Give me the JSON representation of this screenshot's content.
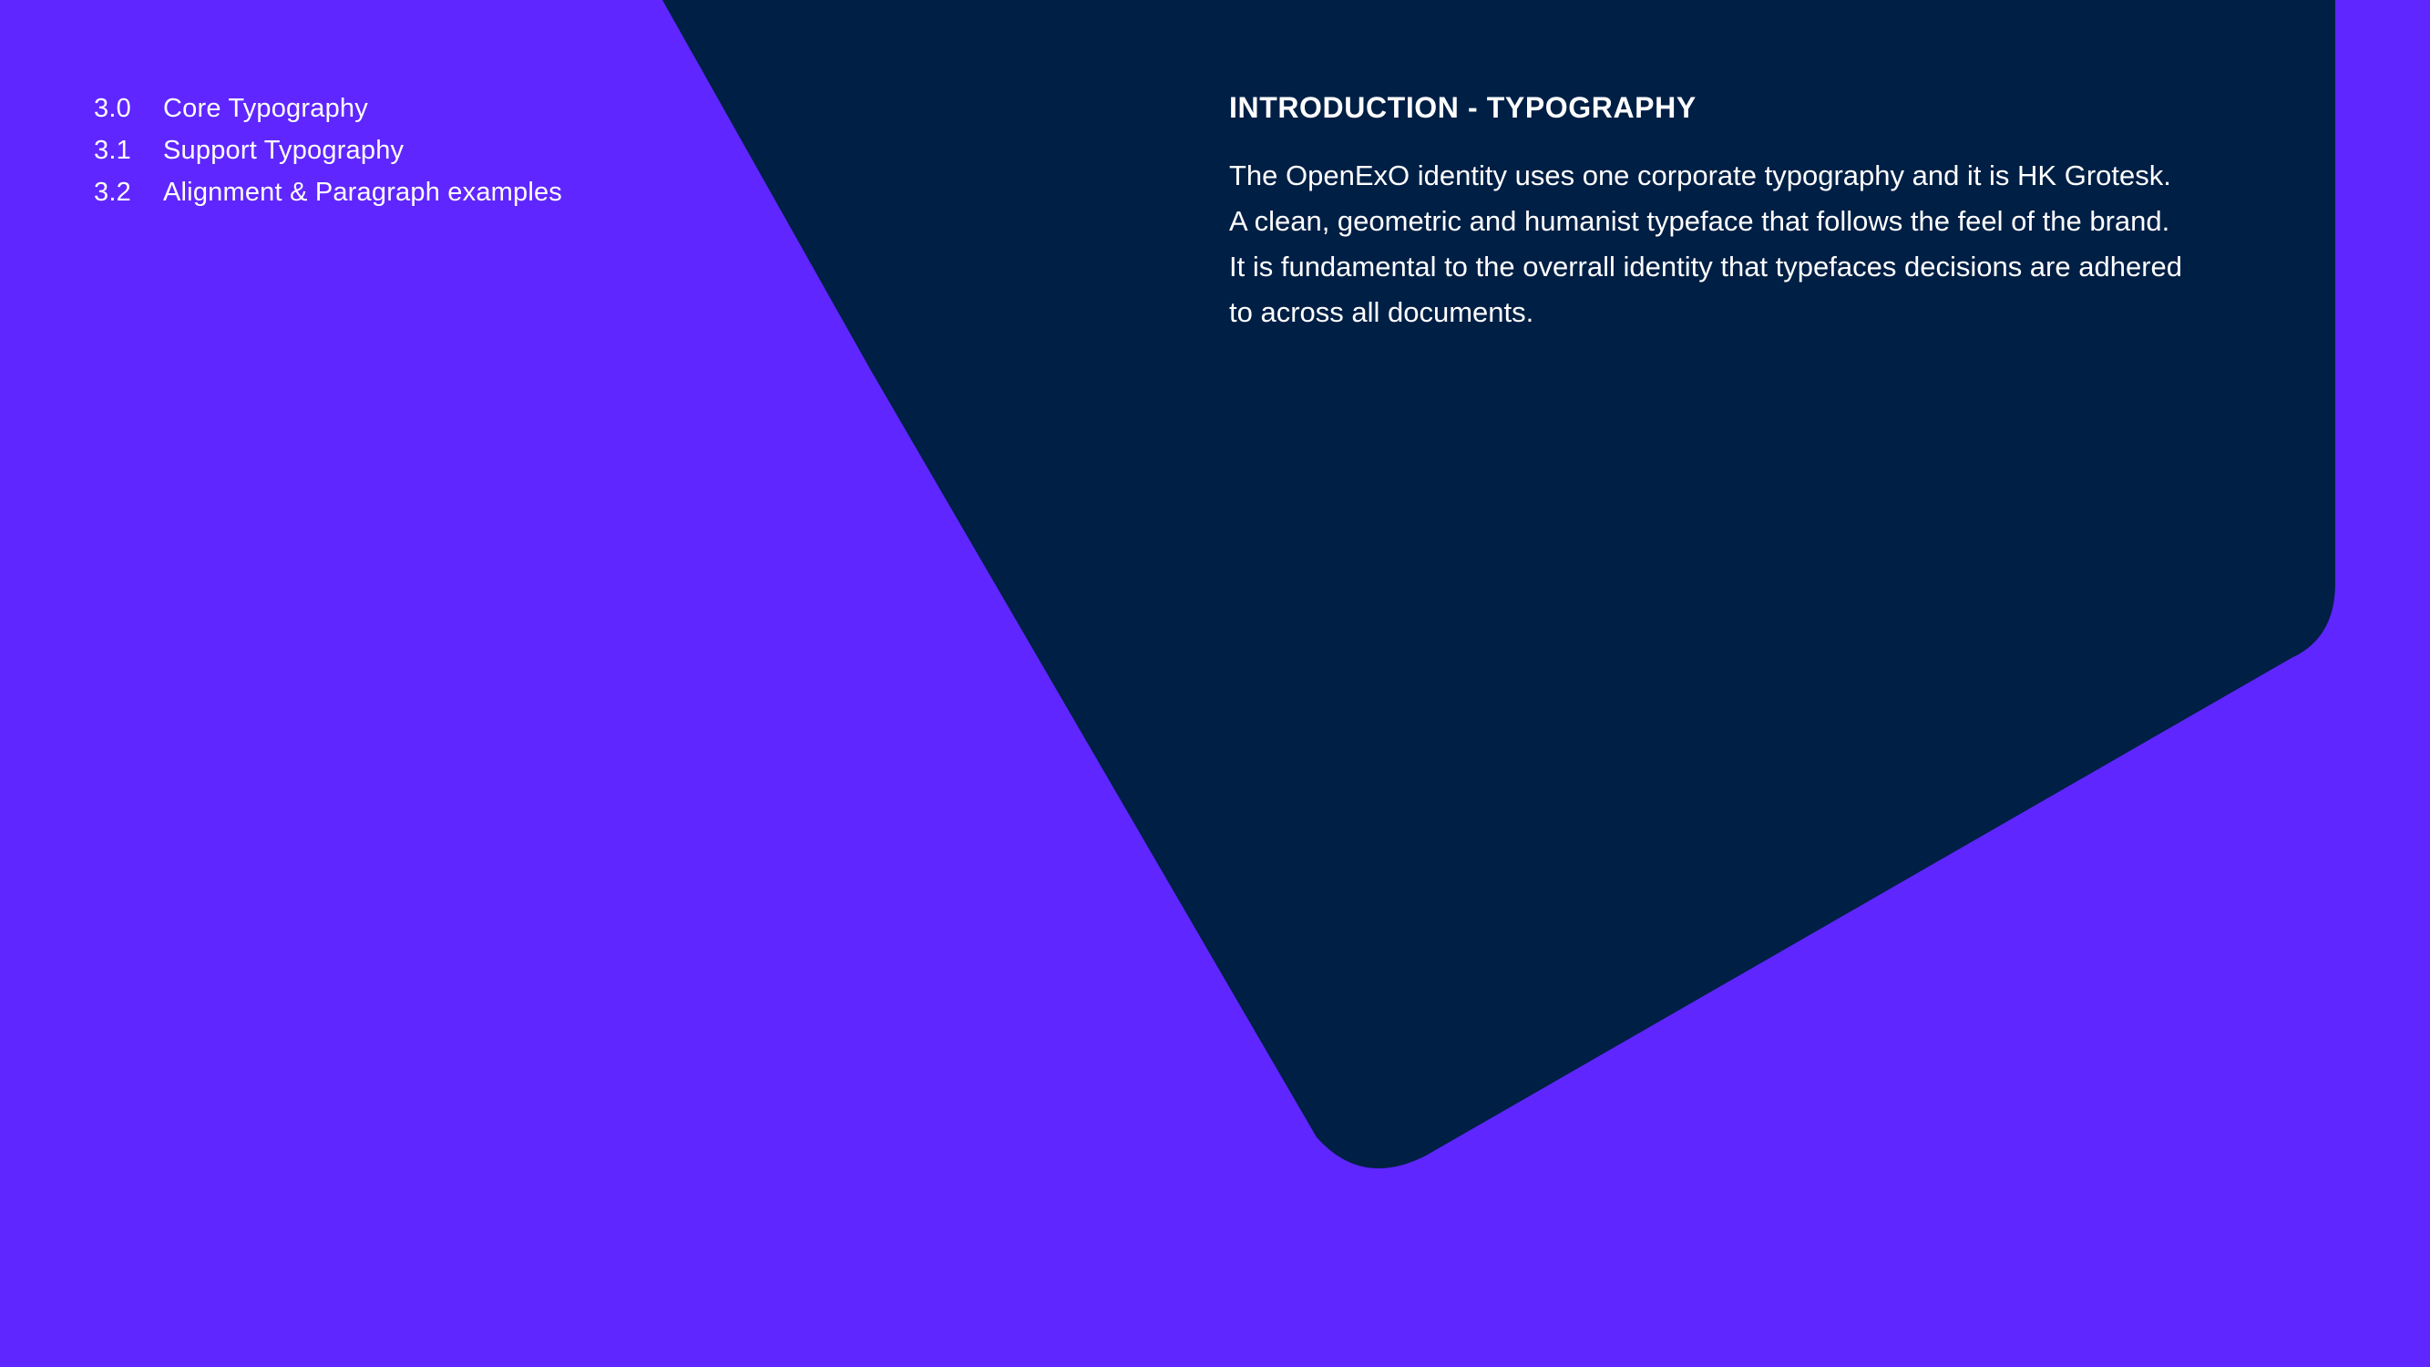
{
  "colors": {
    "background": "#5f26ff",
    "shape": "#001f45",
    "text": "#ffffff"
  },
  "toc": {
    "items": [
      {
        "number": "3.0",
        "label": "Core Typography"
      },
      {
        "number": "3.1",
        "label": "Support Typography"
      },
      {
        "number": "3.2",
        "label": "Alignment & Paragraph examples"
      }
    ]
  },
  "intro": {
    "title": "INTRODUCTION - TYPOGRAPHY",
    "lines": [
      "The OpenExO identity uses one corporate typography and it is HK Grotesk.",
      "A clean, geometric and humanist typeface that follows the feel of the brand.",
      "It is fundamental to the overrall identity that typefaces decisions are adhered",
      "to across all documents."
    ]
  }
}
